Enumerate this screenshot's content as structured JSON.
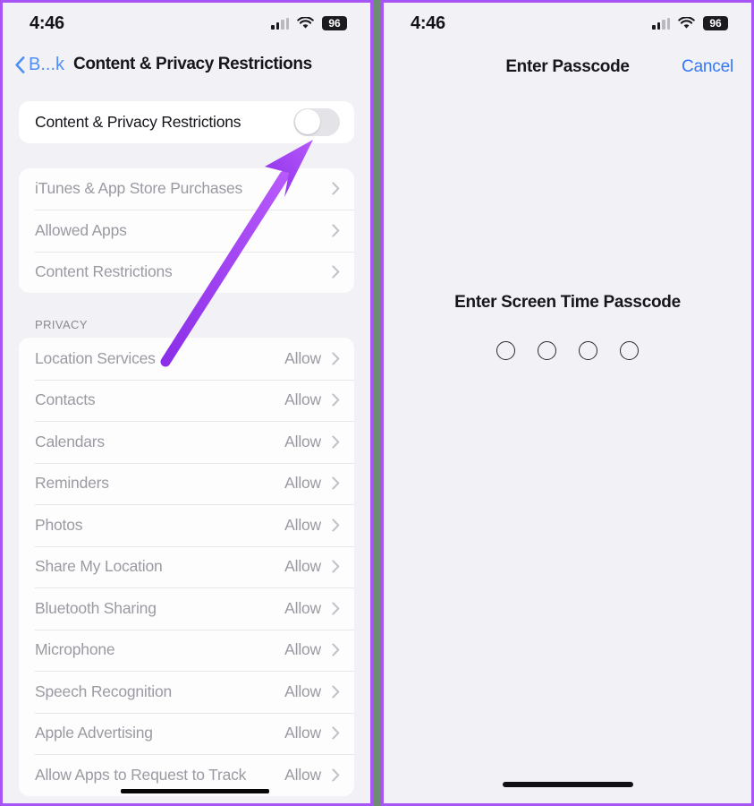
{
  "colors": {
    "accent_blue": "#3478f6",
    "annotation_purple": "#a855f7",
    "frame_border": "#a855f7",
    "screen_background": "#f2f1f6",
    "card_background": "#ffffff",
    "disabled_text": "#9b9aa2"
  },
  "left_screen": {
    "status_bar": {
      "time": "4:46",
      "battery_level": "96",
      "signal_icon": "cellular-signal-icon",
      "wifi_icon": "wifi-icon",
      "battery_icon": "battery-icon"
    },
    "nav": {
      "back_label": "B...k",
      "back_icon": "chevron-left-icon",
      "title": "Content & Privacy Restrictions"
    },
    "master_toggle": {
      "label": "Content & Privacy Restrictions",
      "state": "off"
    },
    "restrictions_group": [
      {
        "label": "iTunes & App Store Purchases",
        "disabled": true
      },
      {
        "label": "Allowed Apps",
        "disabled": true
      },
      {
        "label": "Content Restrictions",
        "disabled": true
      }
    ],
    "privacy_section": {
      "header": "PRIVACY",
      "rows": [
        {
          "label": "Location Services",
          "value": "Allow"
        },
        {
          "label": "Contacts",
          "value": "Allow"
        },
        {
          "label": "Calendars",
          "value": "Allow"
        },
        {
          "label": "Reminders",
          "value": "Allow"
        },
        {
          "label": "Photos",
          "value": "Allow"
        },
        {
          "label": "Share My Location",
          "value": "Allow"
        },
        {
          "label": "Bluetooth Sharing",
          "value": "Allow"
        },
        {
          "label": "Microphone",
          "value": "Allow"
        },
        {
          "label": "Speech Recognition",
          "value": "Allow"
        },
        {
          "label": "Apple Advertising",
          "value": "Allow"
        },
        {
          "label": "Allow Apps to Request to Track",
          "value": "Allow",
          "redacted": true
        }
      ]
    }
  },
  "right_screen": {
    "status_bar": {
      "time": "4:46",
      "battery_level": "96",
      "signal_icon": "cellular-signal-icon",
      "wifi_icon": "wifi-icon",
      "battery_icon": "battery-icon"
    },
    "nav": {
      "title": "Enter Passcode",
      "cancel_label": "Cancel"
    },
    "prompt": "Enter Screen Time Passcode",
    "passcode_dots": 4,
    "passcode_entered": 0
  },
  "annotation": {
    "type": "arrow",
    "points_to": "master-toggle",
    "color": "#a855f7"
  }
}
